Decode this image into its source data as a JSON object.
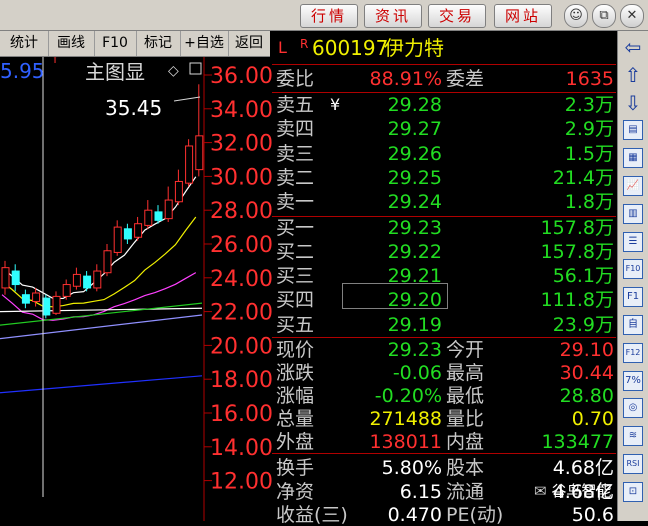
{
  "topbar": {
    "buttons": [
      "行情",
      "资讯",
      "交易",
      "网站"
    ],
    "win_controls": [
      "☺",
      "⧉",
      "✕"
    ]
  },
  "chart_toolbar": {
    "items": [
      "统计",
      "画线",
      "F10",
      "标记",
      "+自选",
      "返回"
    ]
  },
  "chart": {
    "price_marker": "5.95",
    "overlay_label": "主图显",
    "high_label": "35.45",
    "y_ticks": [
      "36.00",
      "34.00",
      "32.00",
      "30.00",
      "28.00",
      "26.00",
      "24.00",
      "22.00",
      "20.00",
      "18.00",
      "16.00",
      "14.00",
      "12.00"
    ],
    "candles": [
      {
        "o": 23.4,
        "c": 24.6,
        "h": 25.0,
        "l": 23.0
      },
      {
        "o": 24.4,
        "c": 23.6,
        "h": 24.8,
        "l": 23.2
      },
      {
        "o": 23.0,
        "c": 22.5,
        "h": 23.3,
        "l": 22.2
      },
      {
        "o": 22.6,
        "c": 23.1,
        "h": 23.4,
        "l": 22.3
      },
      {
        "o": 22.8,
        "c": 21.8,
        "h": 23.0,
        "l": 21.6
      },
      {
        "o": 21.9,
        "c": 22.9,
        "h": 23.2,
        "l": 21.8
      },
      {
        "o": 22.9,
        "c": 23.6,
        "h": 23.9,
        "l": 22.7
      },
      {
        "o": 23.5,
        "c": 24.2,
        "h": 24.6,
        "l": 23.3
      },
      {
        "o": 24.1,
        "c": 23.4,
        "h": 24.4,
        "l": 23.2
      },
      {
        "o": 23.4,
        "c": 24.4,
        "h": 24.8,
        "l": 23.2
      },
      {
        "o": 24.3,
        "c": 25.6,
        "h": 26.0,
        "l": 24.1
      },
      {
        "o": 25.5,
        "c": 27.0,
        "h": 27.4,
        "l": 25.3
      },
      {
        "o": 26.9,
        "c": 26.3,
        "h": 27.2,
        "l": 26.0
      },
      {
        "o": 26.4,
        "c": 27.2,
        "h": 27.6,
        "l": 26.2
      },
      {
        "o": 27.1,
        "c": 28.0,
        "h": 28.6,
        "l": 26.9
      },
      {
        "o": 27.9,
        "c": 27.4,
        "h": 28.3,
        "l": 27.2
      },
      {
        "o": 27.5,
        "c": 28.6,
        "h": 29.4,
        "l": 27.3
      },
      {
        "o": 28.5,
        "c": 29.7,
        "h": 30.4,
        "l": 28.3
      },
      {
        "o": 29.6,
        "c": 31.8,
        "h": 32.2,
        "l": 29.4
      },
      {
        "o": 30.4,
        "c": 32.4,
        "h": 35.45,
        "l": 30.0
      }
    ]
  },
  "quote": {
    "code": "600197",
    "name": "伊力特",
    "flag_l": "L",
    "flag_r": "R",
    "weibi_label": "委比",
    "weibi_value": "88.91%",
    "weicha_label": "委差",
    "weicha_value": "1635",
    "sell": [
      {
        "label": "卖五",
        "price": "29.28",
        "vol": "2.3万"
      },
      {
        "label": "卖四",
        "price": "29.27",
        "vol": "2.9万"
      },
      {
        "label": "卖三",
        "price": "29.26",
        "vol": "1.5万"
      },
      {
        "label": "卖二",
        "price": "29.25",
        "vol": "21.4万"
      },
      {
        "label": "卖一",
        "price": "29.24",
        "vol": "1.8万"
      }
    ],
    "sell_mark": "¥",
    "buy": [
      {
        "label": "买一",
        "price": "29.23",
        "vol": "157.8万"
      },
      {
        "label": "买二",
        "price": "29.22",
        "vol": "157.8万"
      },
      {
        "label": "买三",
        "price": "29.21",
        "vol": "56.1万"
      },
      {
        "label": "买四",
        "price": "29.20",
        "vol": "111.8万"
      },
      {
        "label": "买五",
        "price": "29.19",
        "vol": "23.9万"
      }
    ],
    "stats": [
      {
        "l1": "现价",
        "v1": "29.23",
        "l2": "今开",
        "v2": "29.10"
      },
      {
        "l1": "涨跌",
        "v1": "-0.06",
        "l2": "最高",
        "v2": "30.44"
      },
      {
        "l1": "涨幅",
        "v1": "-0.20%",
        "l2": "最低",
        "v2": "28.80"
      },
      {
        "l1": "总量",
        "v1": "271488",
        "l2": "量比",
        "v2": "0.70"
      },
      {
        "l1": "外盘",
        "v1": "138011",
        "l2": "内盘",
        "v2": "133477"
      }
    ],
    "extra": [
      {
        "l1": "换手",
        "v1": "5.80%",
        "l2": "股本",
        "v2": "4.68亿"
      },
      {
        "l1": "净资",
        "v1": "6.15",
        "l2": "流通",
        "v2": "4.68亿"
      },
      {
        "l1": "收益(三)",
        "v1": "0.470",
        "l2": "PE(动)",
        "v2": "50.6"
      }
    ],
    "watermark": "谷鸟智能"
  },
  "iconbar": {
    "icons": [
      "⇦",
      "⇧",
      "⇩",
      "▤",
      "▦",
      "📈",
      "▥",
      "☰",
      "F10",
      "F1",
      "自",
      "F12",
      "7%",
      "◎",
      "≋",
      "RSI",
      "⊡"
    ]
  }
}
